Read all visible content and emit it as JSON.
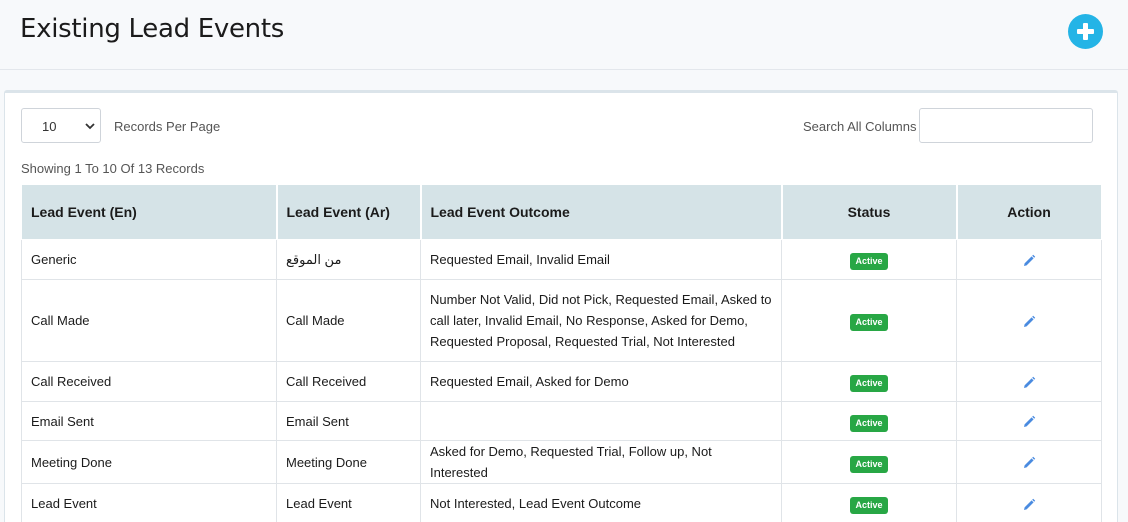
{
  "header": {
    "title": "Existing Lead Events",
    "add_icon": "plus-circle-icon",
    "accent_color": "#24b4e6"
  },
  "controls": {
    "records_per_page": "10",
    "records_per_page_label": "Records Per Page",
    "search_label": "Search All Columns",
    "search_value": ""
  },
  "summary": "Showing 1 To 10 Of 13 Records",
  "table": {
    "columns": [
      "Lead Event (En)",
      "Lead Event (Ar)",
      "Lead Event Outcome",
      "Status",
      "Action"
    ],
    "rows": [
      {
        "en": "Generic",
        "ar": "من الموقع",
        "outcome": "Requested Email, Invalid Email",
        "status": "Active"
      },
      {
        "en": "Call Made",
        "ar": "Call Made",
        "outcome": "Number Not Valid, Did not Pick, Requested Email, Asked to call later, Invalid Email, No Response, Asked for Demo, Requested Proposal, Requested Trial, Not Interested",
        "status": "Active"
      },
      {
        "en": "Call Received",
        "ar": "Call Received",
        "outcome": "Requested Email, Asked for Demo",
        "status": "Active"
      },
      {
        "en": "Email Sent",
        "ar": "Email Sent",
        "outcome": "",
        "status": "Active"
      },
      {
        "en": "Meeting Done",
        "ar": "Meeting Done",
        "outcome": "Asked for Demo, Requested Trial, Follow up, Not Interested",
        "status": "Active"
      },
      {
        "en": "Lead Event",
        "ar": "Lead Event",
        "outcome": "Not Interested, Lead Event Outcome",
        "status": "Active"
      }
    ]
  },
  "status_color": "#28a745",
  "edit_icon": "pencil-icon"
}
